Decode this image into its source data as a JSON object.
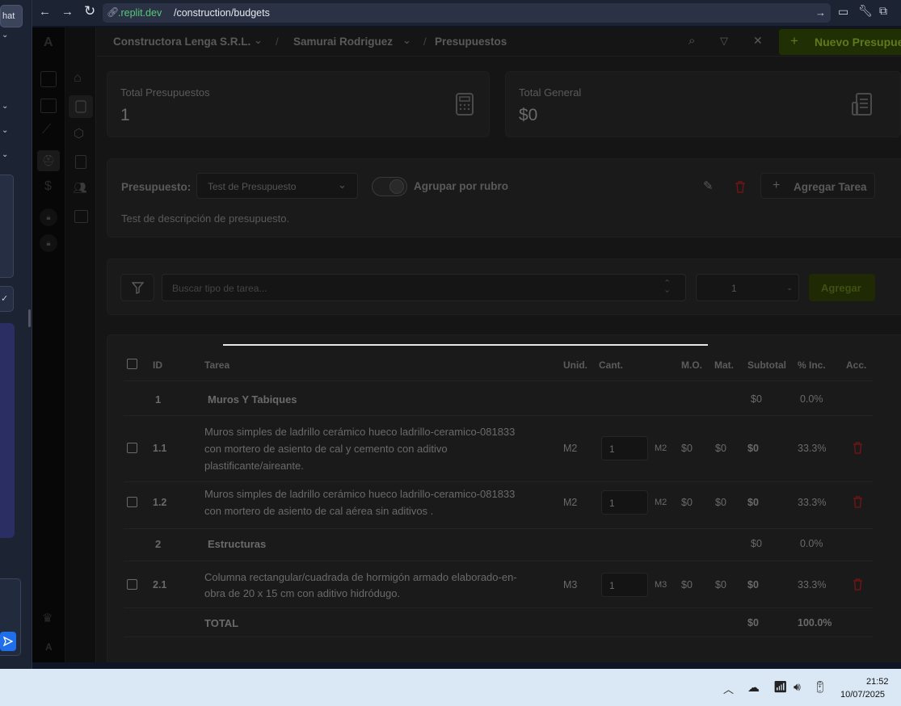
{
  "browser": {
    "url_host": ".replit.dev",
    "url_path": "/construction/budgets"
  },
  "left_panel": {
    "tab_label": "hat"
  },
  "header": {
    "company": "Constructora Lenga S.R.L.",
    "person": "Samurai Rodriguez",
    "section": "Presupuestos",
    "new_button": "Nuevo Presupuesto",
    "sep1": "/",
    "sep2": "/",
    "plus": "+"
  },
  "stats": {
    "total_label": "Total Presupuestos",
    "total_value": "1",
    "general_label": "Total General",
    "general_value": "$0"
  },
  "budget": {
    "label": "Presupuesto:",
    "selected": "Test de Presupuesto",
    "toggle_label": "Agrupar por rubro",
    "add_task": "Agregar Tarea",
    "description": "Test de descripción de presupuesto."
  },
  "search": {
    "placeholder": "Buscar tipo de tarea...",
    "qty_value": "1",
    "qty_suffix": "-",
    "add_button": "Agregar"
  },
  "table": {
    "headers": {
      "id": "ID",
      "task": "Tarea",
      "unit": "Unid.",
      "qty": "Cant.",
      "mo": "M.O.",
      "mat": "Mat.",
      "subtotal": "Subtotal",
      "pct": "% Inc.",
      "acc": "Acc."
    },
    "groups": [
      {
        "id": "1",
        "name": "Muros Y Tabiques",
        "subtotal": "$0",
        "pct": "0.0%"
      },
      {
        "id": "2",
        "name": "Estructuras",
        "subtotal": "$0",
        "pct": "0.0%"
      }
    ],
    "rows": [
      {
        "id": "1.1",
        "line1": "Muros simples de ladrillo cerámico hueco ladrillo-ceramico-081833",
        "line2": "con mortero de asiento de cal y cemento con aditivo",
        "line3": "plastificante/aireante.",
        "unit": "M2",
        "qty": "1",
        "qty_unit": "M2",
        "mo": "$0",
        "mat": "$0",
        "subtotal": "$0",
        "pct": "33.3%"
      },
      {
        "id": "1.2",
        "line1": "Muros simples de ladrillo cerámico hueco ladrillo-ceramico-081833",
        "line2": "con mortero de asiento de cal aérea sin aditivos .",
        "unit": "M2",
        "qty": "1",
        "qty_unit": "M2",
        "mo": "$0",
        "mat": "$0",
        "subtotal": "$0",
        "pct": "33.3%"
      },
      {
        "id": "2.1",
        "line1": "Columna rectangular/cuadrada de hormigón armado elaborado-en-",
        "line2": "obra de 20 x 15 cm con aditivo hidródugo.",
        "unit": "M3",
        "qty": "1",
        "qty_unit": "M3",
        "mo": "$0",
        "mat": "$0",
        "subtotal": "$0",
        "pct": "33.3%"
      }
    ],
    "total": {
      "label": "TOTAL",
      "subtotal": "$0",
      "pct": "100.0%"
    }
  },
  "taskbar": {
    "time": "21:52",
    "date": "10/07/2025"
  },
  "rail": {
    "logo": "A",
    "bottom": "A"
  },
  "colors": {
    "accent_green": "#2c3e06",
    "danger_red": "#6b1515",
    "chrome": "#1c2333",
    "taskbar": "#d9e8f4"
  }
}
